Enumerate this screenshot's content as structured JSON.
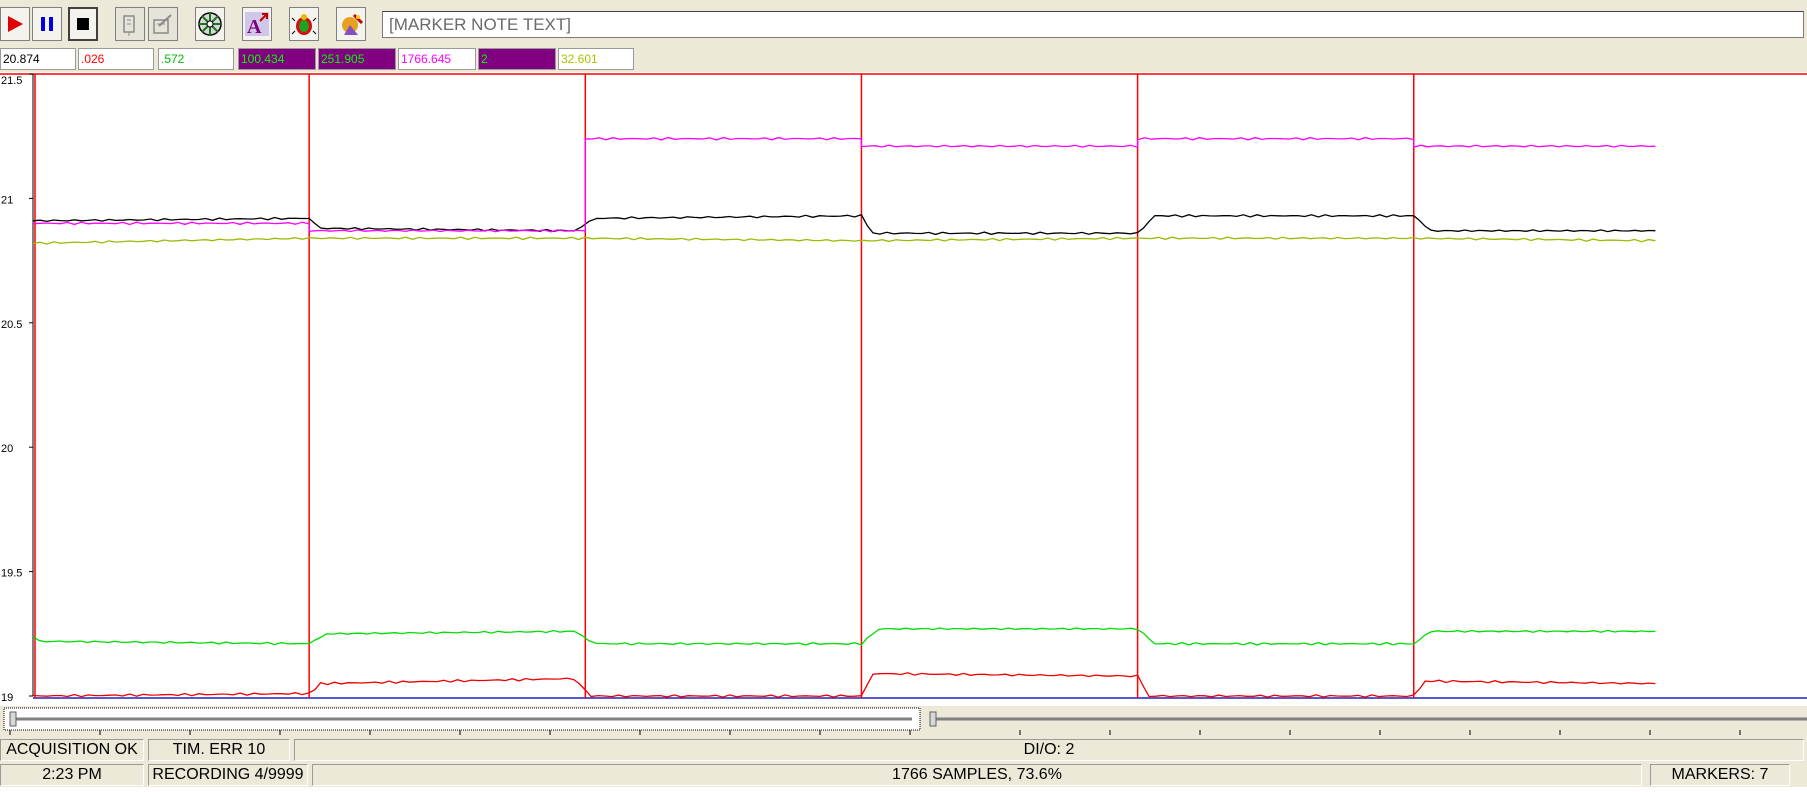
{
  "toolbar": {
    "marker_note_placeholder": "[MARKER NOTE TEXT]",
    "buttons": [
      {
        "name": "play-icon"
      },
      {
        "name": "pause-icon"
      },
      {
        "name": "stop-icon"
      },
      {
        "name": "marker-edit-icon"
      },
      {
        "name": "marker-list-icon"
      },
      {
        "name": "disk-icon"
      },
      {
        "name": "annotate-icon"
      },
      {
        "name": "bug-icon"
      },
      {
        "name": "wizard-icon"
      }
    ]
  },
  "readouts": [
    {
      "value": "20.874",
      "fg": "#000000",
      "bg": "#ffffff"
    },
    {
      "value": ".026",
      "fg": "#ff0000",
      "bg": "#ffffff"
    },
    {
      "value": ".572",
      "fg": "#00c000",
      "bg": "#ffffff"
    },
    {
      "value": "100.434",
      "fg": "#00ff00",
      "bg": "#800080"
    },
    {
      "value": "251.905",
      "fg": "#00ff00",
      "bg": "#800080"
    },
    {
      "value": "1766.645",
      "fg": "#ff00ff",
      "bg": "#ffffff"
    },
    {
      "value": "2",
      "fg": "#00ff00",
      "bg": "#800080"
    },
    {
      "value": "32.601",
      "fg": "#b0c000",
      "bg": "#ffffff"
    }
  ],
  "chart_data": {
    "type": "line",
    "y_ticks": [
      "21.5",
      "21",
      "20.5",
      "20",
      "19.5",
      "19"
    ],
    "ylim": [
      19,
      21.5
    ],
    "grid": false,
    "marker_color": "#ff0000",
    "marker_samples": [
      0,
      240,
      480,
      720,
      960,
      1200
    ],
    "x_range": [
      0,
      1766
    ],
    "sample_count": 1766,
    "series": [
      {
        "color": "#000000",
        "points": [
          [
            0,
            20.91
          ],
          [
            240,
            20.92
          ],
          [
            250,
            20.88
          ],
          [
            470,
            20.87
          ],
          [
            490,
            20.92
          ],
          [
            720,
            20.93
          ],
          [
            730,
            20.86
          ],
          [
            960,
            20.86
          ],
          [
            975,
            20.93
          ],
          [
            1200,
            20.93
          ],
          [
            1215,
            20.87
          ],
          [
            1410,
            20.87
          ]
        ]
      },
      {
        "color": "#ff00ff",
        "points": [
          [
            0,
            20.9
          ],
          [
            240,
            20.9
          ],
          [
            240,
            20.87
          ],
          [
            480,
            20.87
          ],
          [
            480,
            21.24
          ],
          [
            720,
            21.24
          ],
          [
            720,
            21.21
          ],
          [
            960,
            21.21
          ],
          [
            960,
            21.24
          ],
          [
            1200,
            21.24
          ],
          [
            1200,
            21.21
          ],
          [
            1410,
            21.21
          ]
        ]
      },
      {
        "color": "#99bb00",
        "points": [
          [
            0,
            20.82
          ],
          [
            240,
            20.84
          ],
          [
            480,
            20.84
          ],
          [
            720,
            20.83
          ],
          [
            960,
            20.84
          ],
          [
            1200,
            20.84
          ],
          [
            1410,
            20.83
          ]
        ]
      },
      {
        "color": "#00dd00",
        "points": [
          [
            0,
            19.24
          ],
          [
            5,
            19.22
          ],
          [
            240,
            19.21
          ],
          [
            255,
            19.25
          ],
          [
            470,
            19.26
          ],
          [
            490,
            19.21
          ],
          [
            720,
            19.21
          ],
          [
            735,
            19.27
          ],
          [
            960,
            19.27
          ],
          [
            975,
            19.21
          ],
          [
            1200,
            19.21
          ],
          [
            1215,
            19.26
          ],
          [
            1410,
            19.26
          ]
        ]
      },
      {
        "color": "#ee0000",
        "points": [
          [
            0,
            19.0
          ],
          [
            240,
            19.01
          ],
          [
            250,
            19.05
          ],
          [
            470,
            19.07
          ],
          [
            485,
            19.0
          ],
          [
            720,
            19.0
          ],
          [
            730,
            19.09
          ],
          [
            960,
            19.08
          ],
          [
            970,
            19.0
          ],
          [
            1200,
            19.0
          ],
          [
            1210,
            19.06
          ],
          [
            1410,
            19.05
          ]
        ]
      }
    ]
  },
  "status": {
    "acquisition": "ACQUISITION OK",
    "timing": "TIM. ERR 10",
    "dio": "DI/O: 2",
    "time": "2:23 PM",
    "recording": "RECORDING 4/9999",
    "samples": "1766 SAMPLES, 73.6%",
    "markers": "MARKERS: 7"
  }
}
